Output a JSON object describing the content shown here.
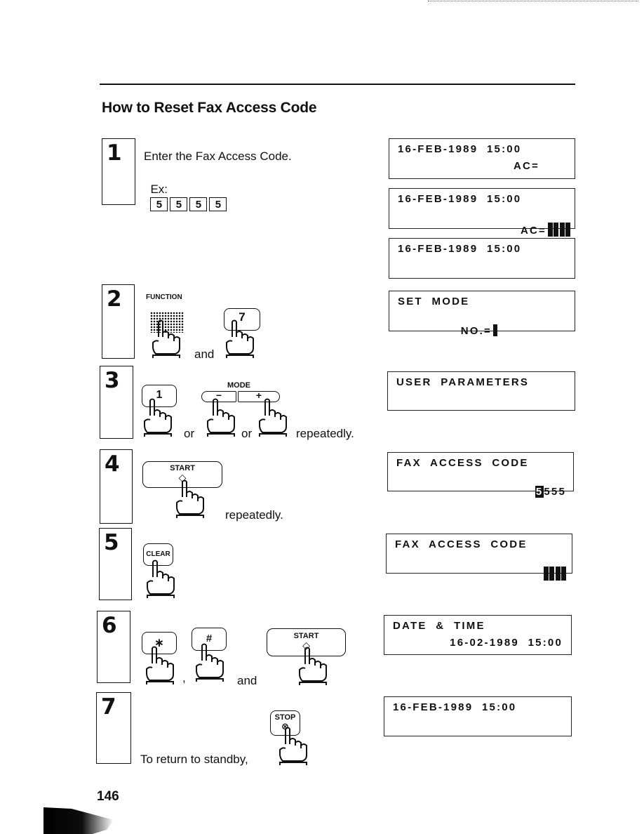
{
  "page": {
    "title": "How to Reset Fax Access Code",
    "page_number": "146"
  },
  "steps": [
    {
      "number": "1",
      "text": "Enter the Fax Access Code.",
      "example_label": "Ex:",
      "example_keys": [
        "5",
        "5",
        "5",
        "5"
      ]
    },
    {
      "number": "2",
      "function_label": "FUNCTION",
      "key_label": "7",
      "connector": "and"
    },
    {
      "number": "3",
      "key_label": "1",
      "mode_label": "MODE",
      "mode_minus": "−",
      "mode_plus": "+",
      "connector_1": "or",
      "connector_2": "or",
      "suffix": "repeatedly."
    },
    {
      "number": "4",
      "key_label": "START",
      "suffix": "repeatedly."
    },
    {
      "number": "5",
      "key_label": "CLEAR"
    },
    {
      "number": "6",
      "key_1": "∗",
      "key_2": "#",
      "key_3": "START",
      "separator": ",",
      "connector": "and"
    },
    {
      "number": "7",
      "text": "To return to standby,",
      "key_label": "STOP"
    }
  ],
  "displays": [
    {
      "line1": "16-FEB-1989  15:00",
      "line2": "AC="
    },
    {
      "line1": "16-FEB-1989  15:00",
      "line2": "AC=",
      "masked_digits": 4
    },
    {
      "line1": "16-FEB-1989  15:00",
      "line2": ""
    },
    {
      "line1": "SET  MODE",
      "line2": "NO.="
    },
    {
      "line1": "USER  PARAMETERS",
      "line2": ""
    },
    {
      "line1": "FAX  ACCESS  CODE",
      "line2_highlight": "5",
      "line2_rest": "555"
    },
    {
      "line1": "FAX  ACCESS  CODE",
      "line2": "",
      "masked_digits": 4
    },
    {
      "line1": "DATE  &  TIME",
      "line2": "16-02-1989  15:00"
    },
    {
      "line1": "16-FEB-1989  15:00",
      "line2": ""
    }
  ]
}
